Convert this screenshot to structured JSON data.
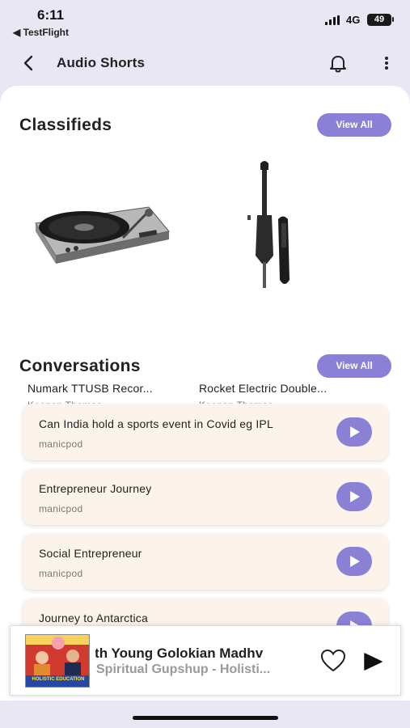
{
  "status_bar": {
    "time": "6:11",
    "back_app": "◀ TestFlight",
    "network": "4G",
    "battery": "49"
  },
  "header": {
    "title": "Audio Shorts",
    "back_icon": "chevron-left-icon",
    "bell_icon": "bell-icon",
    "more_icon": "more-vertical-icon"
  },
  "classifieds": {
    "title": "Classifieds",
    "view_all": "View All",
    "items": [
      {
        "name": "Numark TTUSB Recor...",
        "author": "Keenan Thomas",
        "image": "turntable"
      },
      {
        "name": "Rocket Electric Double...",
        "author": "Keenan Thomas",
        "image": "electric-double-bass"
      }
    ]
  },
  "conversations": {
    "title": "Conversations",
    "view_all": "View All",
    "items": [
      {
        "title": "Can India hold a sports event in Covid eg IPL",
        "author": "manicpod"
      },
      {
        "title": "Entrepreneur Journey",
        "author": "manicpod"
      },
      {
        "title": "Social Entrepreneur",
        "author": "manicpod"
      },
      {
        "title": "Journey to Antarctica",
        "author": ""
      }
    ]
  },
  "player": {
    "title": "p with Young Golokian Madhv",
    "subtitle": "Spiritual Gupshup - Holisti...",
    "thumb_text": "HOLISTIC EDUCATION",
    "heart_icon": "heart-outline-icon",
    "play_icon": "play-icon"
  },
  "colors": {
    "accent": "#8a80d6",
    "card_bg": "#fcf4ea",
    "page_bg": "#e9e7f4"
  }
}
